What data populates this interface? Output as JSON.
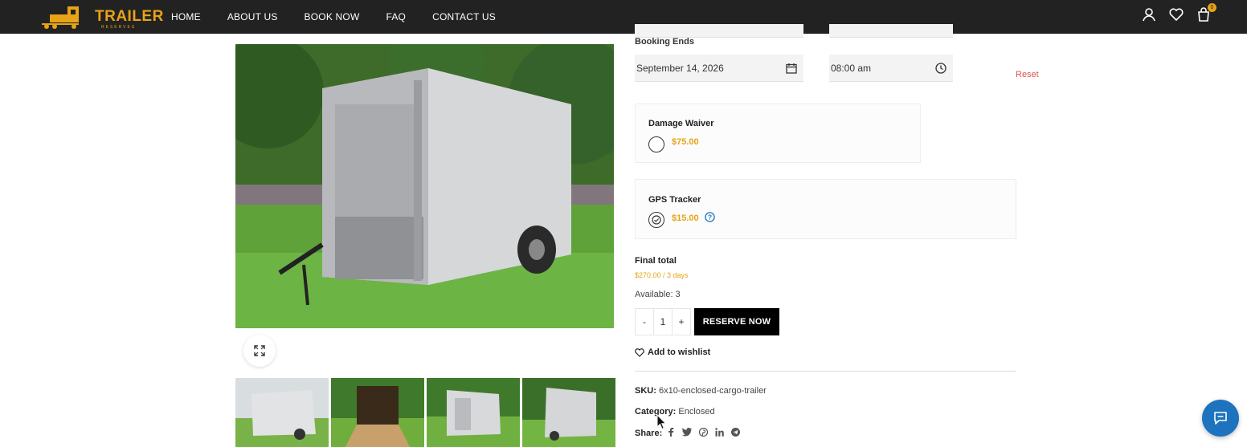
{
  "header": {
    "logo_text": "TRAILER",
    "logo_sub": "RESERVES",
    "nav": [
      "HOME",
      "ABOUT US",
      "BOOK NOW",
      "FAQ",
      "CONTACT US"
    ],
    "cart_count": "0"
  },
  "booking": {
    "ends_label": "Booking Ends",
    "end_date": "September 14, 2026",
    "end_time": "08:00 am",
    "reset_label": "Reset"
  },
  "addons": [
    {
      "title": "Damage Waiver",
      "price": "$75.00",
      "selected": false
    },
    {
      "title": "GPS Tracker",
      "price": "$15.00",
      "selected": true
    }
  ],
  "totals": {
    "final_label": "Final total",
    "final_value": "$270.00 / 3 days",
    "available": "Available: 3"
  },
  "purchase": {
    "minus": "-",
    "qty": "1",
    "plus": "+",
    "reserve_label": "RESERVE NOW",
    "wishlist_label": "Add to wishlist"
  },
  "meta": {
    "sku_label": "SKU:",
    "sku_value": "6x10-enclosed-cargo-trailer",
    "category_label": "Category:",
    "category_value": "Enclosed",
    "share_label": "Share:"
  },
  "colors": {
    "accent": "#e8a317",
    "header_bg": "#222222",
    "chat": "#1e73be",
    "reset": "#d9534f"
  }
}
